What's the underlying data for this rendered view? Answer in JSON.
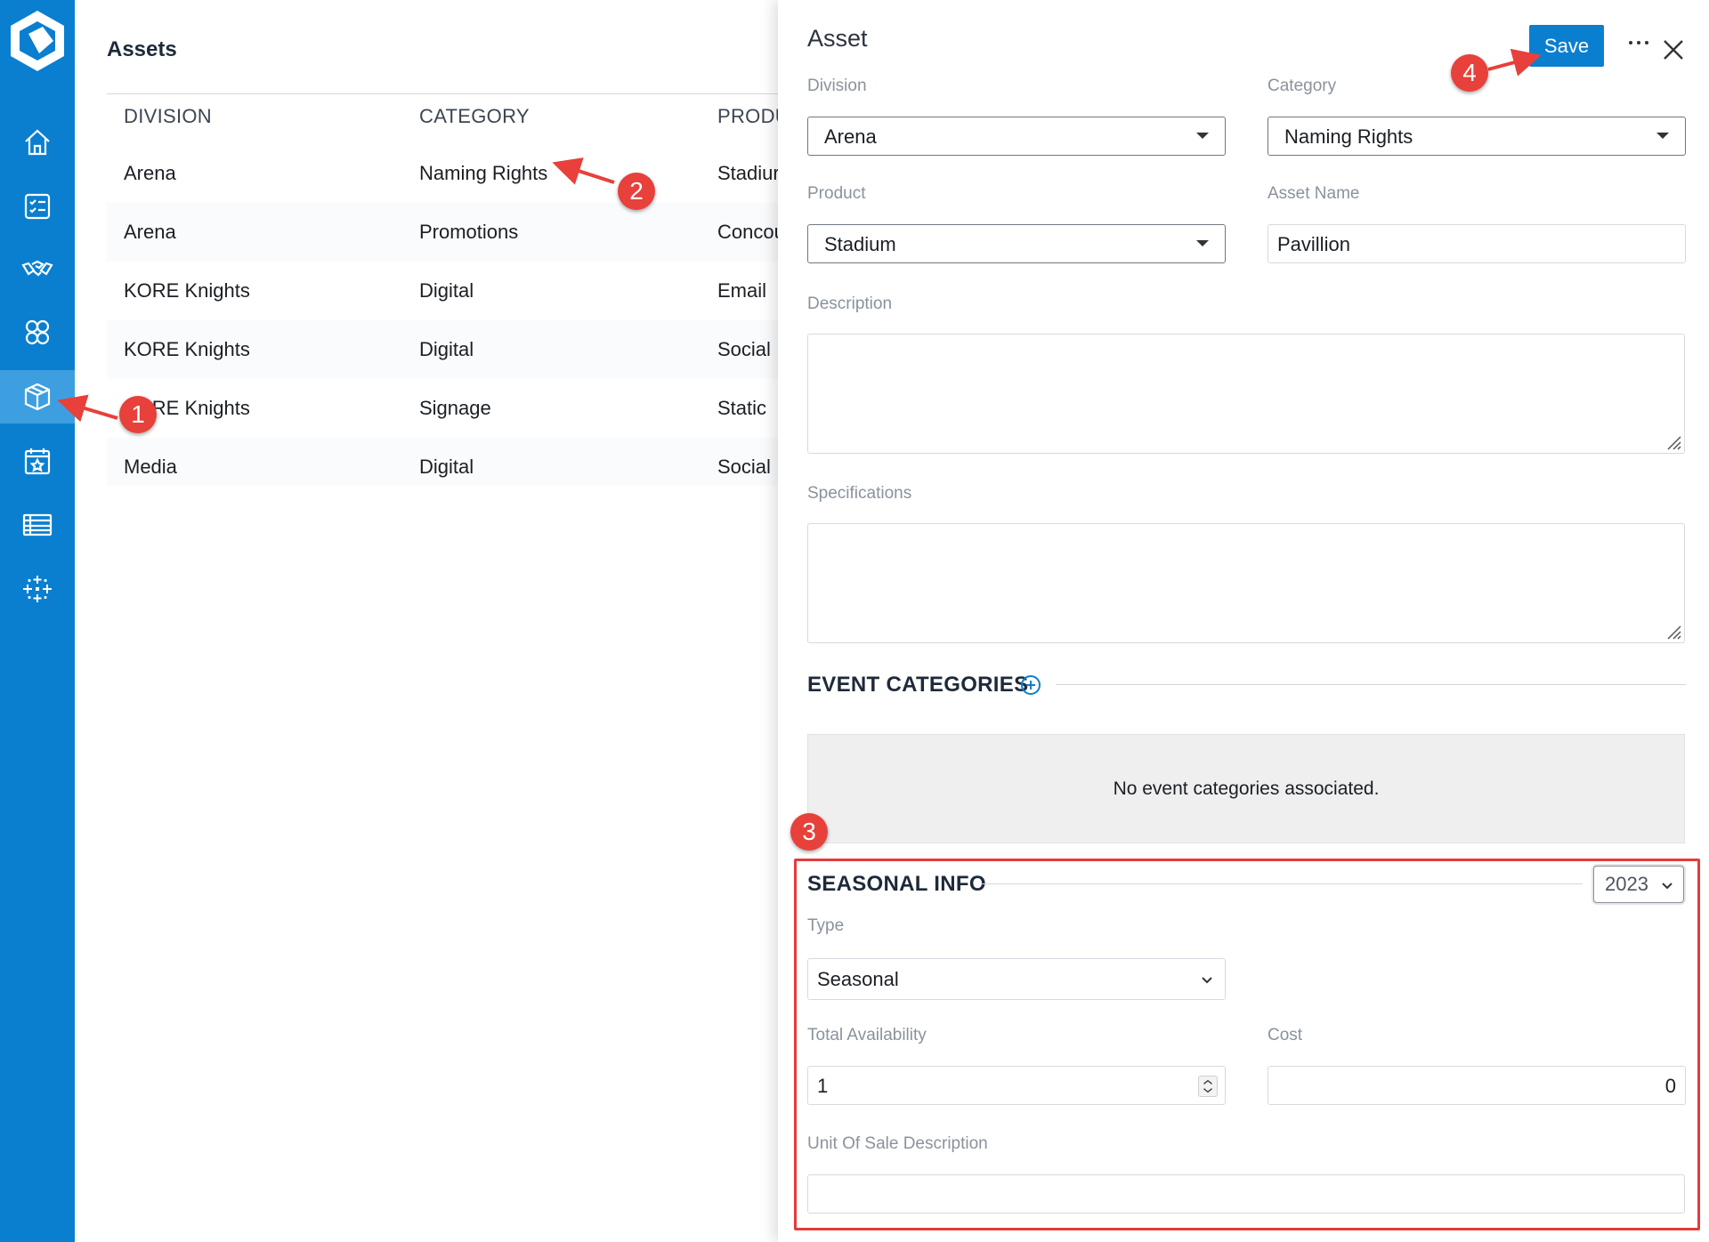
{
  "sidebar": {
    "logo": "app-logo",
    "items": [
      {
        "icon": "home-icon",
        "active": false
      },
      {
        "icon": "checklist-icon",
        "active": false
      },
      {
        "icon": "handshake-icon",
        "active": false
      },
      {
        "icon": "groups-icon",
        "active": false
      },
      {
        "icon": "box-icon",
        "active": true
      },
      {
        "icon": "calendar-star-icon",
        "active": false
      },
      {
        "icon": "table-icon",
        "active": false
      },
      {
        "icon": "sparkle-grid-icon",
        "active": false
      }
    ]
  },
  "list": {
    "title": "Assets",
    "headers": [
      "DIVISION",
      "CATEGORY",
      "PRODU"
    ],
    "rows": [
      {
        "division": "Arena",
        "category": "Naming Rights",
        "product": "Stadiur"
      },
      {
        "division": "Arena",
        "category": "Promotions",
        "product": "Concou"
      },
      {
        "division": "KORE Knights",
        "category": "Digital",
        "product": "Email"
      },
      {
        "division": "KORE Knights",
        "category": "Digital",
        "product": "Social"
      },
      {
        "division": "KORE Knights",
        "category": "Signage",
        "product": "Static"
      },
      {
        "division": "Media",
        "category": "Digital",
        "product": "Social"
      }
    ]
  },
  "panel": {
    "title": "Asset",
    "save_label": "Save",
    "more_icon": "more-horizontal-icon",
    "close_icon": "close-icon",
    "division": {
      "label": "Division",
      "value": "Arena"
    },
    "category": {
      "label": "Category",
      "value": "Naming Rights"
    },
    "product": {
      "label": "Product",
      "value": "Stadium"
    },
    "asset_name": {
      "label": "Asset Name",
      "value": "Pavillion"
    },
    "description": {
      "label": "Description",
      "value": ""
    },
    "specifications": {
      "label": "Specifications",
      "value": ""
    },
    "event_categories": {
      "title": "EVENT CATEGORIES",
      "empty_text": "No event categories associated."
    },
    "seasonal": {
      "title": "SEASONAL INFO",
      "year": "2023",
      "type": {
        "label": "Type",
        "value": "Seasonal"
      },
      "total_availability": {
        "label": "Total Availability",
        "value": "1"
      },
      "cost": {
        "label": "Cost",
        "value": "0"
      },
      "unit_of_sale": {
        "label": "Unit Of Sale Description",
        "value": ""
      }
    }
  },
  "annotations": [
    "1",
    "2",
    "3",
    "4"
  ],
  "colors": {
    "brand": "#0a7fd0",
    "annotation": "#e8403a"
  }
}
